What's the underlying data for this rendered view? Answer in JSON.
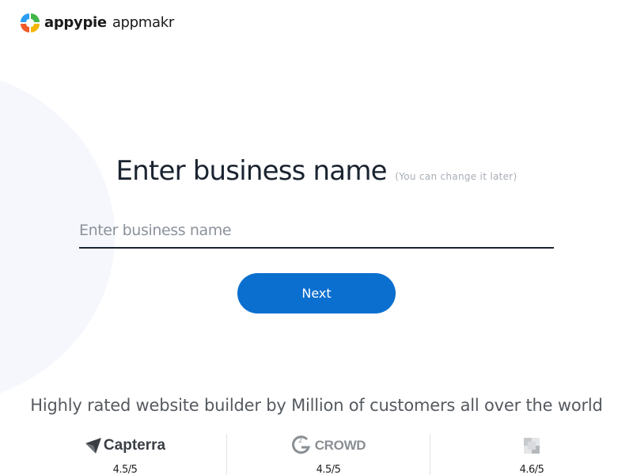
{
  "header": {
    "brand": "appypie",
    "product": "appmakr"
  },
  "main": {
    "heading": "Enter business name",
    "heading_note": "(You can change it later)",
    "input_placeholder": "Enter business name",
    "input_value": "",
    "next_label": "Next"
  },
  "ratings": {
    "headline": "Highly rated website builder by Million of customers all over the world",
    "items": [
      {
        "name": "Capterra",
        "score": "4.5/5"
      },
      {
        "name": "CROWD",
        "score": "4.5/5"
      },
      {
        "name": "",
        "score": "4.6/5"
      }
    ]
  },
  "colors": {
    "accent": "#0b6fd0",
    "text_dark": "#1b2430",
    "muted": "#a7adb5"
  }
}
